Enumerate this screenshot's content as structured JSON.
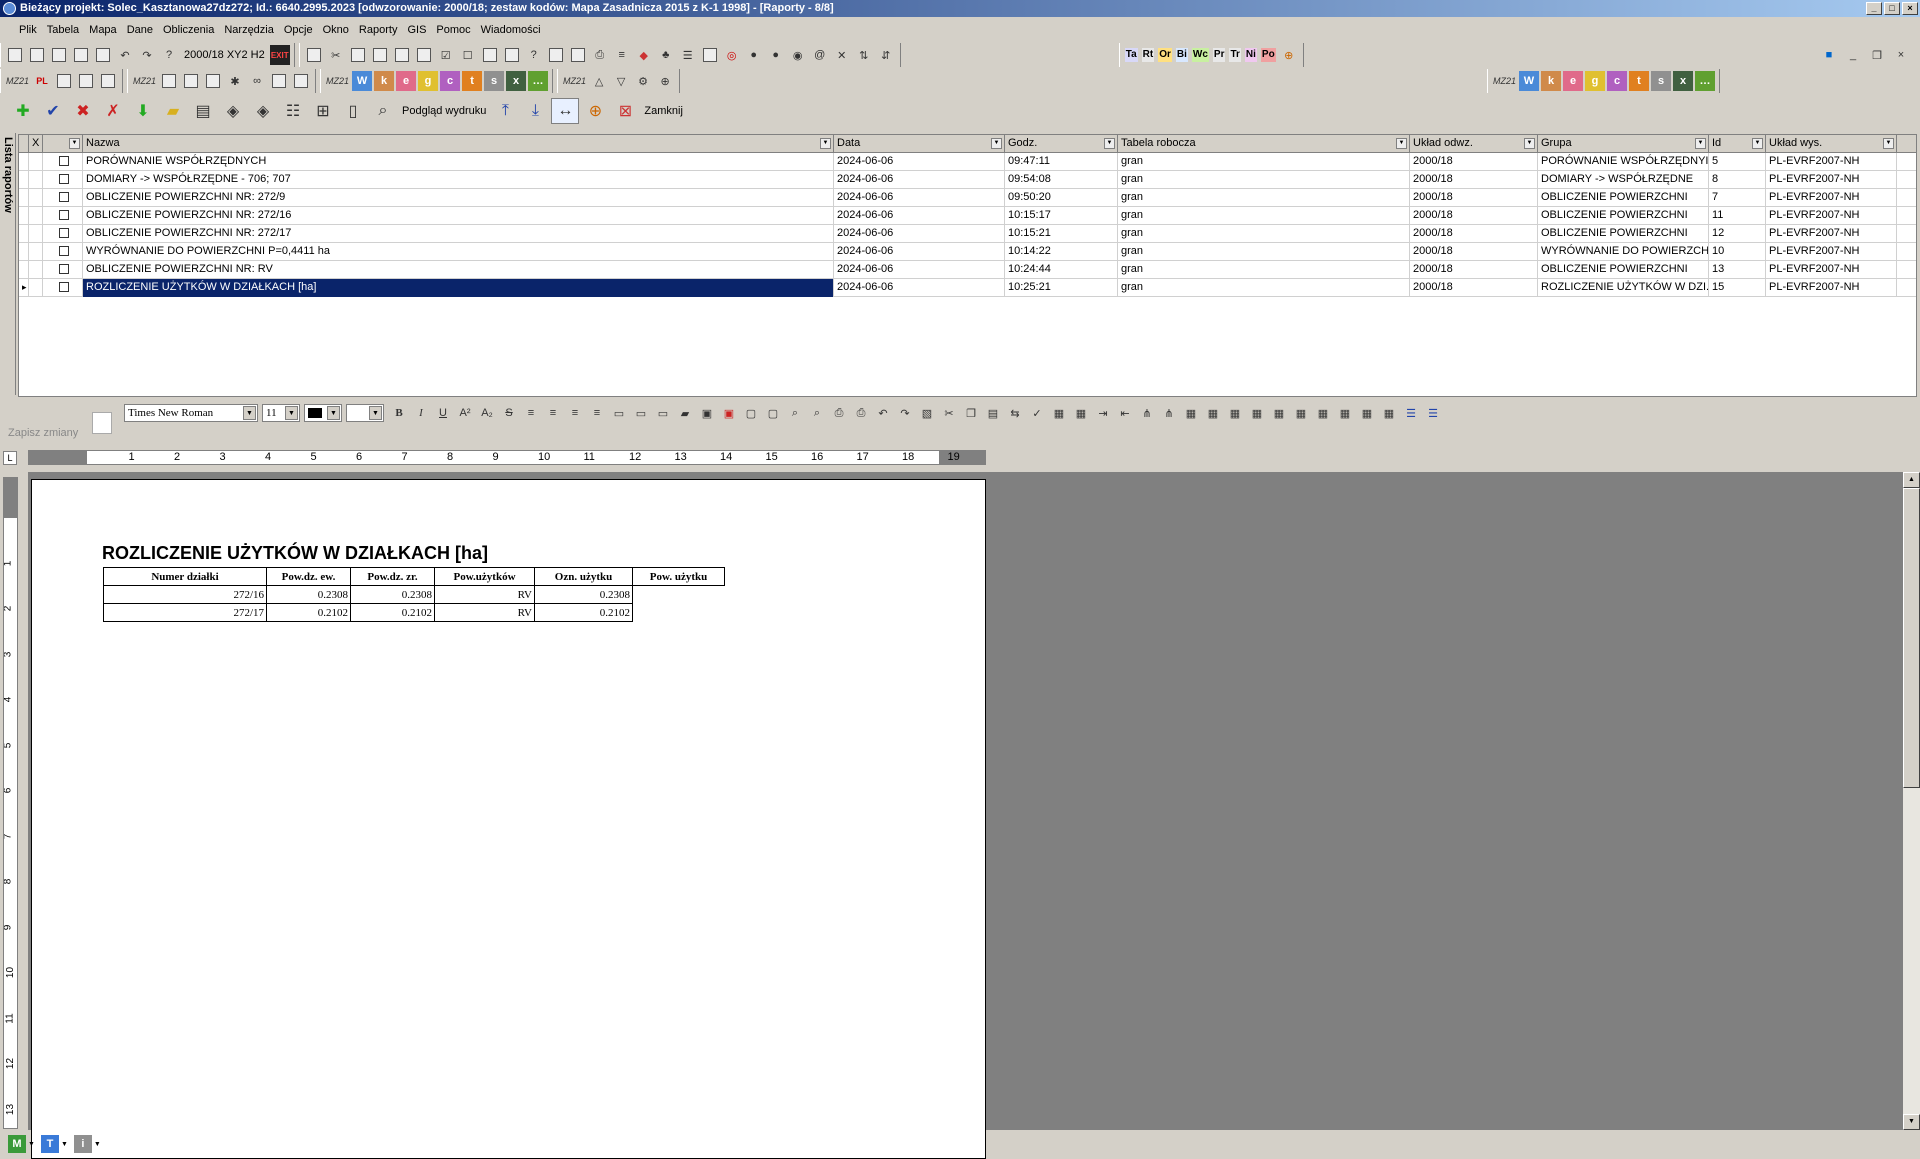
{
  "window": {
    "title": "Bieżący projekt: Solec_Kasztanowa27dz272; Id.: 6640.2995.2023 [odwzorowanie: 2000/18; zestaw kodów: Mapa Zasadnicza 2015 z K-1 1998] - [Raporty - 8/8]"
  },
  "menu": [
    "Plik",
    "Tabela",
    "Mapa",
    "Dane",
    "Obliczenia",
    "Narzędzia",
    "Opcje",
    "Okno",
    "Raporty",
    "GIS",
    "Pomoc",
    "Wiadomości"
  ],
  "toolbar": {
    "coord_label": "2000/18 XY2 H2",
    "mz_label": "MZ21",
    "chips": [
      {
        "text": "Ta",
        "color": "#d8d8f8"
      },
      {
        "text": "Rt",
        "color": "#e8e8e8"
      },
      {
        "text": "Or",
        "color": "#ffe080"
      },
      {
        "text": "Bi",
        "color": "#d8e8ff"
      },
      {
        "text": "Wc",
        "color": "#c8f0a0"
      },
      {
        "text": "Pr",
        "color": "#e8e8e8"
      },
      {
        "text": "Tr",
        "color": "#e8e8e8"
      },
      {
        "text": "Ni",
        "color": "#f0c8f0"
      },
      {
        "text": "Po",
        "color": "#f0a0a0"
      }
    ],
    "preview_label": "Podgląd wydruku",
    "close_label": "Zamknij"
  },
  "sidebar": {
    "tab_label": "Lista raportów"
  },
  "grid": {
    "headers": {
      "x": "X",
      "nazwa": "Nazwa",
      "data": "Data",
      "godz": "Godz.",
      "tabela": "Tabela robocza",
      "uklad": "Układ odwz.",
      "grupa": "Grupa",
      "id": "Id",
      "uklad_wys": "Układ wys."
    },
    "rows": [
      {
        "nazwa": "PORÓWNANIE WSPÓŁRZĘDNYCH",
        "data": "2024-06-06",
        "godz": "09:47:11",
        "tabela": "gran",
        "uklad": "2000/18",
        "grupa": "PORÓWNANIE WSPÓŁRZĘDNYI",
        "id": "5",
        "uklad_wys": "PL-EVRF2007-NH"
      },
      {
        "nazwa": "DOMIARY -> WSPÓŁRZĘDNE - 706; 707",
        "data": "2024-06-06",
        "godz": "09:54:08",
        "tabela": "gran",
        "uklad": "2000/18",
        "grupa": "DOMIARY -> WSPÓŁRZĘDNE",
        "id": "8",
        "uklad_wys": "PL-EVRF2007-NH"
      },
      {
        "nazwa": "OBLICZENIE POWIERZCHNI NR: 272/9",
        "data": "2024-06-06",
        "godz": "09:50:20",
        "tabela": "gran",
        "uklad": "2000/18",
        "grupa": "OBLICZENIE POWIERZCHNI",
        "id": "7",
        "uklad_wys": "PL-EVRF2007-NH"
      },
      {
        "nazwa": "OBLICZENIE POWIERZCHNI NR: 272/16",
        "data": "2024-06-06",
        "godz": "10:15:17",
        "tabela": "gran",
        "uklad": "2000/18",
        "grupa": "OBLICZENIE POWIERZCHNI",
        "id": "11",
        "uklad_wys": "PL-EVRF2007-NH"
      },
      {
        "nazwa": "OBLICZENIE POWIERZCHNI NR: 272/17",
        "data": "2024-06-06",
        "godz": "10:15:21",
        "tabela": "gran",
        "uklad": "2000/18",
        "grupa": "OBLICZENIE POWIERZCHNI",
        "id": "12",
        "uklad_wys": "PL-EVRF2007-NH"
      },
      {
        "nazwa": "WYRÓWNANIE DO POWIERZCHNI P=0,4411 ha",
        "data": "2024-06-06",
        "godz": "10:14:22",
        "tabela": "gran",
        "uklad": "2000/18",
        "grupa": "WYRÓWNANIE DO POWIERZCH",
        "id": "10",
        "uklad_wys": "PL-EVRF2007-NH"
      },
      {
        "nazwa": "OBLICZENIE POWIERZCHNI NR: RV",
        "data": "2024-06-06",
        "godz": "10:24:44",
        "tabela": "gran",
        "uklad": "2000/18",
        "grupa": "OBLICZENIE POWIERZCHNI",
        "id": "13",
        "uklad_wys": "PL-EVRF2007-NH"
      },
      {
        "nazwa": "ROZLICZENIE UŻYTKÓW W DZIAŁKACH [ha]",
        "data": "2024-06-06",
        "godz": "10:25:21",
        "tabela": "gran",
        "uklad": "2000/18",
        "grupa": "ROZLICZENIE UŻYTKÓW W DZI.",
        "id": "15",
        "uklad_wys": "PL-EVRF2007-NH",
        "selected": true
      }
    ]
  },
  "editor": {
    "save_label": "Zapisz zmiany",
    "font_name": "Times New Roman",
    "font_size": "11",
    "ruler_numbers": [
      "1",
      "2",
      "3",
      "4",
      "5",
      "6",
      "7",
      "8",
      "9",
      "10",
      "11",
      "12",
      "13",
      "14",
      "15",
      "16",
      "17",
      "18",
      "19"
    ],
    "vruler_numbers": [
      "1",
      "2",
      "3",
      "4",
      "5",
      "6",
      "7",
      "8",
      "9",
      "10",
      "11",
      "12",
      "13"
    ]
  },
  "document": {
    "title": "ROZLICZENIE UŻYTKÓW W DZIAŁKACH [ha]",
    "table_headers": [
      "Numer działki",
      "Pow.dz. ew.",
      "Pow.dz. zr.",
      "Pow.użytków",
      "Ozn. użytku",
      "Pow. użytku"
    ],
    "rows": [
      [
        "272/16",
        "0.2308",
        "0.2308",
        "RV",
        "0.2308"
      ],
      [
        "272/17",
        "0.2102",
        "0.2102",
        "RV",
        "0.2102"
      ]
    ]
  },
  "statusbar": {
    "items": [
      {
        "text": "M",
        "color": "#3a9a3a"
      },
      {
        "text": "T",
        "color": "#3a7ad8"
      },
      {
        "text": "i",
        "color": "#909090"
      }
    ]
  }
}
